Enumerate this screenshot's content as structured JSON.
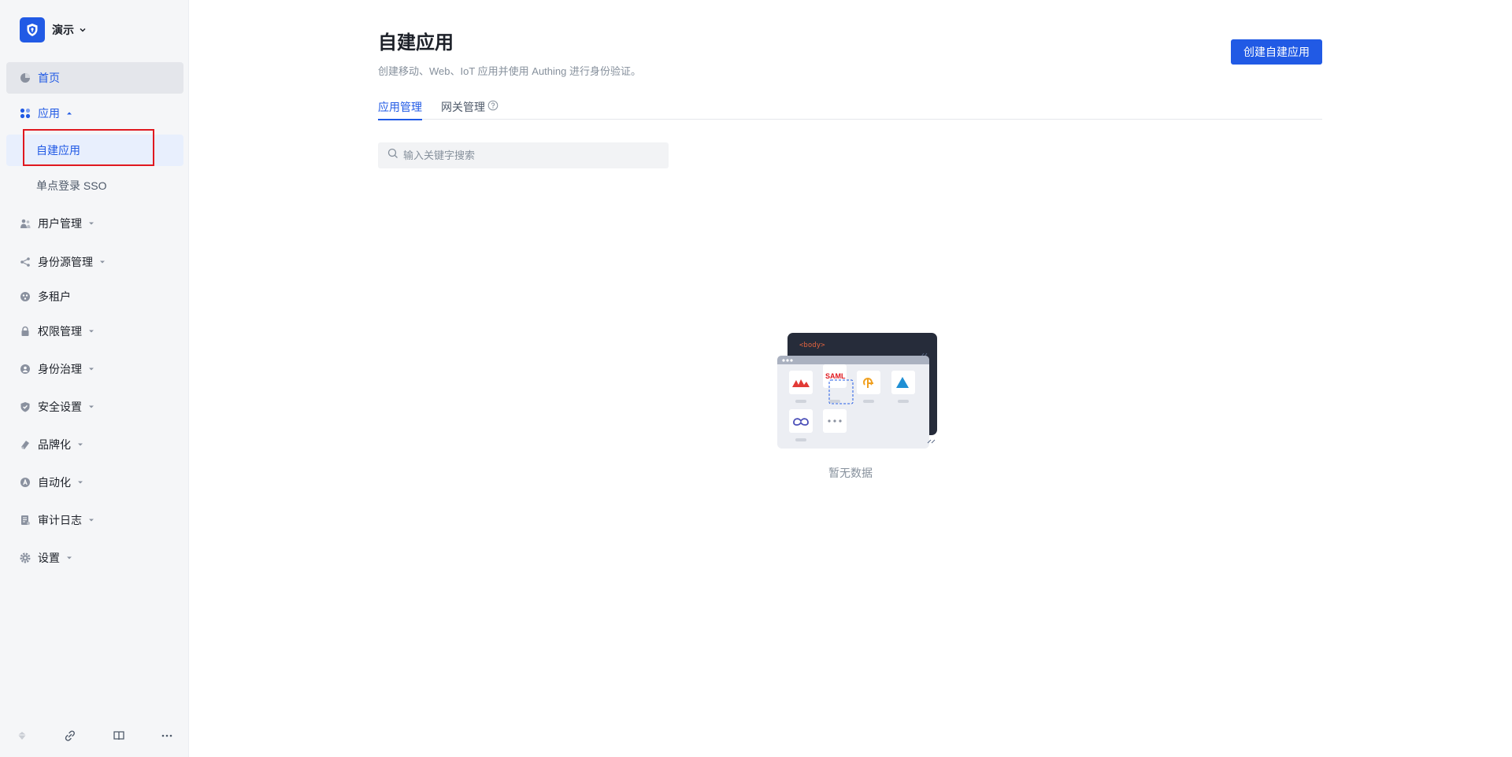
{
  "org": {
    "name": "演示"
  },
  "nav": {
    "home": "首页",
    "apps": "应用",
    "apps_children": [
      "自建应用",
      "单点登录 SSO"
    ],
    "users": "用户管理",
    "idp": "身份源管理",
    "tenant": "多租户",
    "permissions": "权限管理",
    "governance": "身份治理",
    "security": "安全设置",
    "branding": "品牌化",
    "automation": "自动化",
    "audit": "审计日志",
    "settings": "设置"
  },
  "main": {
    "title": "自建应用",
    "description": "创建移动、Web、IoT 应用并使用 Authing 进行身份验证。",
    "create_button": "创建自建应用",
    "tabs": [
      "应用管理",
      "网关管理"
    ],
    "search_placeholder": "输入关键字搜索",
    "empty_text": "暂无数据",
    "illustration": {
      "code_tag": "<body>",
      "saml_label": "SAML"
    }
  },
  "colors": {
    "accent": "#215ae5",
    "highlight": "#e0181f"
  }
}
